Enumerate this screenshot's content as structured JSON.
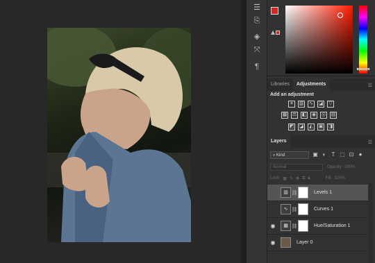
{
  "panels": {
    "libraries_tab": "Libraries",
    "adjustments_tab": "Adjustments",
    "adjustments_title": "Add an adjustment",
    "layers_tab": "Layers"
  },
  "layers_toolbar": {
    "kind_label": "⌕ Kind",
    "blend_mode": "Normal",
    "opacity_label": "Opacity:",
    "opacity_value": "100%",
    "lock_label": "Lock:",
    "fill_label": "Fill:",
    "fill_value": "100%"
  },
  "layers": [
    {
      "name": "Levels 1",
      "thumb": "levels-icon",
      "visible": false,
      "selected": true
    },
    {
      "name": "Curves 1",
      "thumb": "curves-icon",
      "visible": false,
      "selected": false
    },
    {
      "name": "Hue/Saturation 1",
      "thumb": "hue-saturation-icon",
      "visible": true,
      "selected": false
    },
    {
      "name": "Layer 0",
      "thumb": "photo-thumbnail",
      "visible": true,
      "selected": false
    }
  ],
  "colors": {
    "foreground": "#d12a20",
    "background": "#000000"
  }
}
